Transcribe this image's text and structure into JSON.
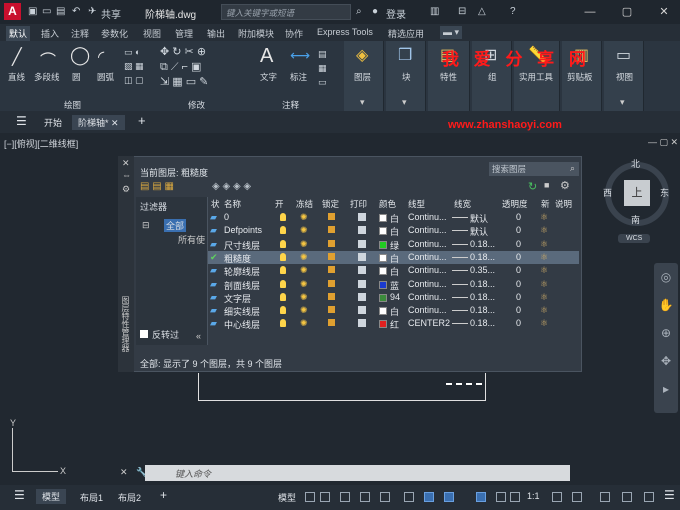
{
  "titlebar": {
    "share": "共享",
    "filename": "阶梯轴.dwg",
    "search_placeholder": "键入关键字或短语",
    "login": "登录"
  },
  "ribbon_tabs": [
    "默认",
    "插入",
    "注释",
    "参数化",
    "视图",
    "管理",
    "输出",
    "附加模块",
    "协作",
    "Express Tools",
    "精选应用"
  ],
  "ribbon": {
    "draw_buttons": [
      "直线",
      "多段线",
      "圆",
      "圆弧"
    ],
    "draw_panel": "绘图",
    "modify_panel": "修改",
    "text_button": "文字",
    "dim_button": "标注",
    "annotate_panel": "注释",
    "layer_button": "图层",
    "block_button": "块",
    "props_button": "特性",
    "group_button": "组",
    "utils_button": "实用工具",
    "clipboard_button": "剪贴板",
    "view_button": "视图"
  },
  "watermark": {
    "line1": "我 爱 分 享 网",
    "line2": "www.zhanshaoyi.com"
  },
  "file_tabs": {
    "start": "开始",
    "active": "阶梯轴*"
  },
  "view_label": "[−][俯视][二维线框]",
  "layer_panel": {
    "current_layer": "当前图层: 粗糙度",
    "search_placeholder": "搜索图层",
    "filter_header": "过滤器",
    "filter_all": "全部",
    "filter_used": "所有使",
    "invert_filter": "反转过",
    "side_title": "图层特性管理器",
    "columns": [
      "状",
      "名称",
      "开",
      "冻结",
      "锁定",
      "打印",
      "颜色",
      "线型",
      "线宽",
      "透明度",
      "新",
      "说明"
    ],
    "rows": [
      {
        "name": "0",
        "color_name": "白",
        "color": "#ffffff",
        "linetype": "Continu...",
        "lineweight": "默认",
        "transparency": "0",
        "current": false
      },
      {
        "name": "Defpoints",
        "color_name": "白",
        "color": "#ffffff",
        "linetype": "Continu...",
        "lineweight": "默认",
        "transparency": "0",
        "current": false
      },
      {
        "name": "尺寸线层",
        "color_name": "绿",
        "color": "#22cc22",
        "linetype": "Continu...",
        "lineweight": "0.18...",
        "transparency": "0",
        "current": false
      },
      {
        "name": "粗糙度",
        "color_name": "白",
        "color": "#ffffff",
        "linetype": "Continu...",
        "lineweight": "0.18...",
        "transparency": "0",
        "current": true
      },
      {
        "name": "轮廓线层",
        "color_name": "白",
        "color": "#ffffff",
        "linetype": "Continu...",
        "lineweight": "0.35...",
        "transparency": "0",
        "current": false
      },
      {
        "name": "剖面线层",
        "color_name": "蓝",
        "color": "#1a3ad0",
        "linetype": "Continu...",
        "lineweight": "0.18...",
        "transparency": "0",
        "current": false
      },
      {
        "name": "文字层",
        "color_name": "94",
        "color": "#3b8a3b",
        "linetype": "Continu...",
        "lineweight": "0.18...",
        "transparency": "0",
        "current": false
      },
      {
        "name": "细实线层",
        "color_name": "白",
        "color": "#ffffff",
        "linetype": "Continu...",
        "lineweight": "0.18...",
        "transparency": "0",
        "current": false
      },
      {
        "name": "中心线层",
        "color_name": "红",
        "color": "#e02020",
        "linetype": "CENTER2",
        "lineweight": "0.18...",
        "transparency": "0",
        "current": false
      }
    ],
    "footer": "全部: 显示了 9 个图层，共 9 个图层"
  },
  "compass": {
    "north": "北",
    "south": "南",
    "east": "东",
    "west": "西",
    "top": "上",
    "wcs": "WCS"
  },
  "command_placeholder": "键入命令",
  "statusbar": {
    "model_tab": "模型",
    "layout1": "布局1",
    "layout2": "布局2",
    "model_btn": "模型",
    "scale": "1:1"
  }
}
